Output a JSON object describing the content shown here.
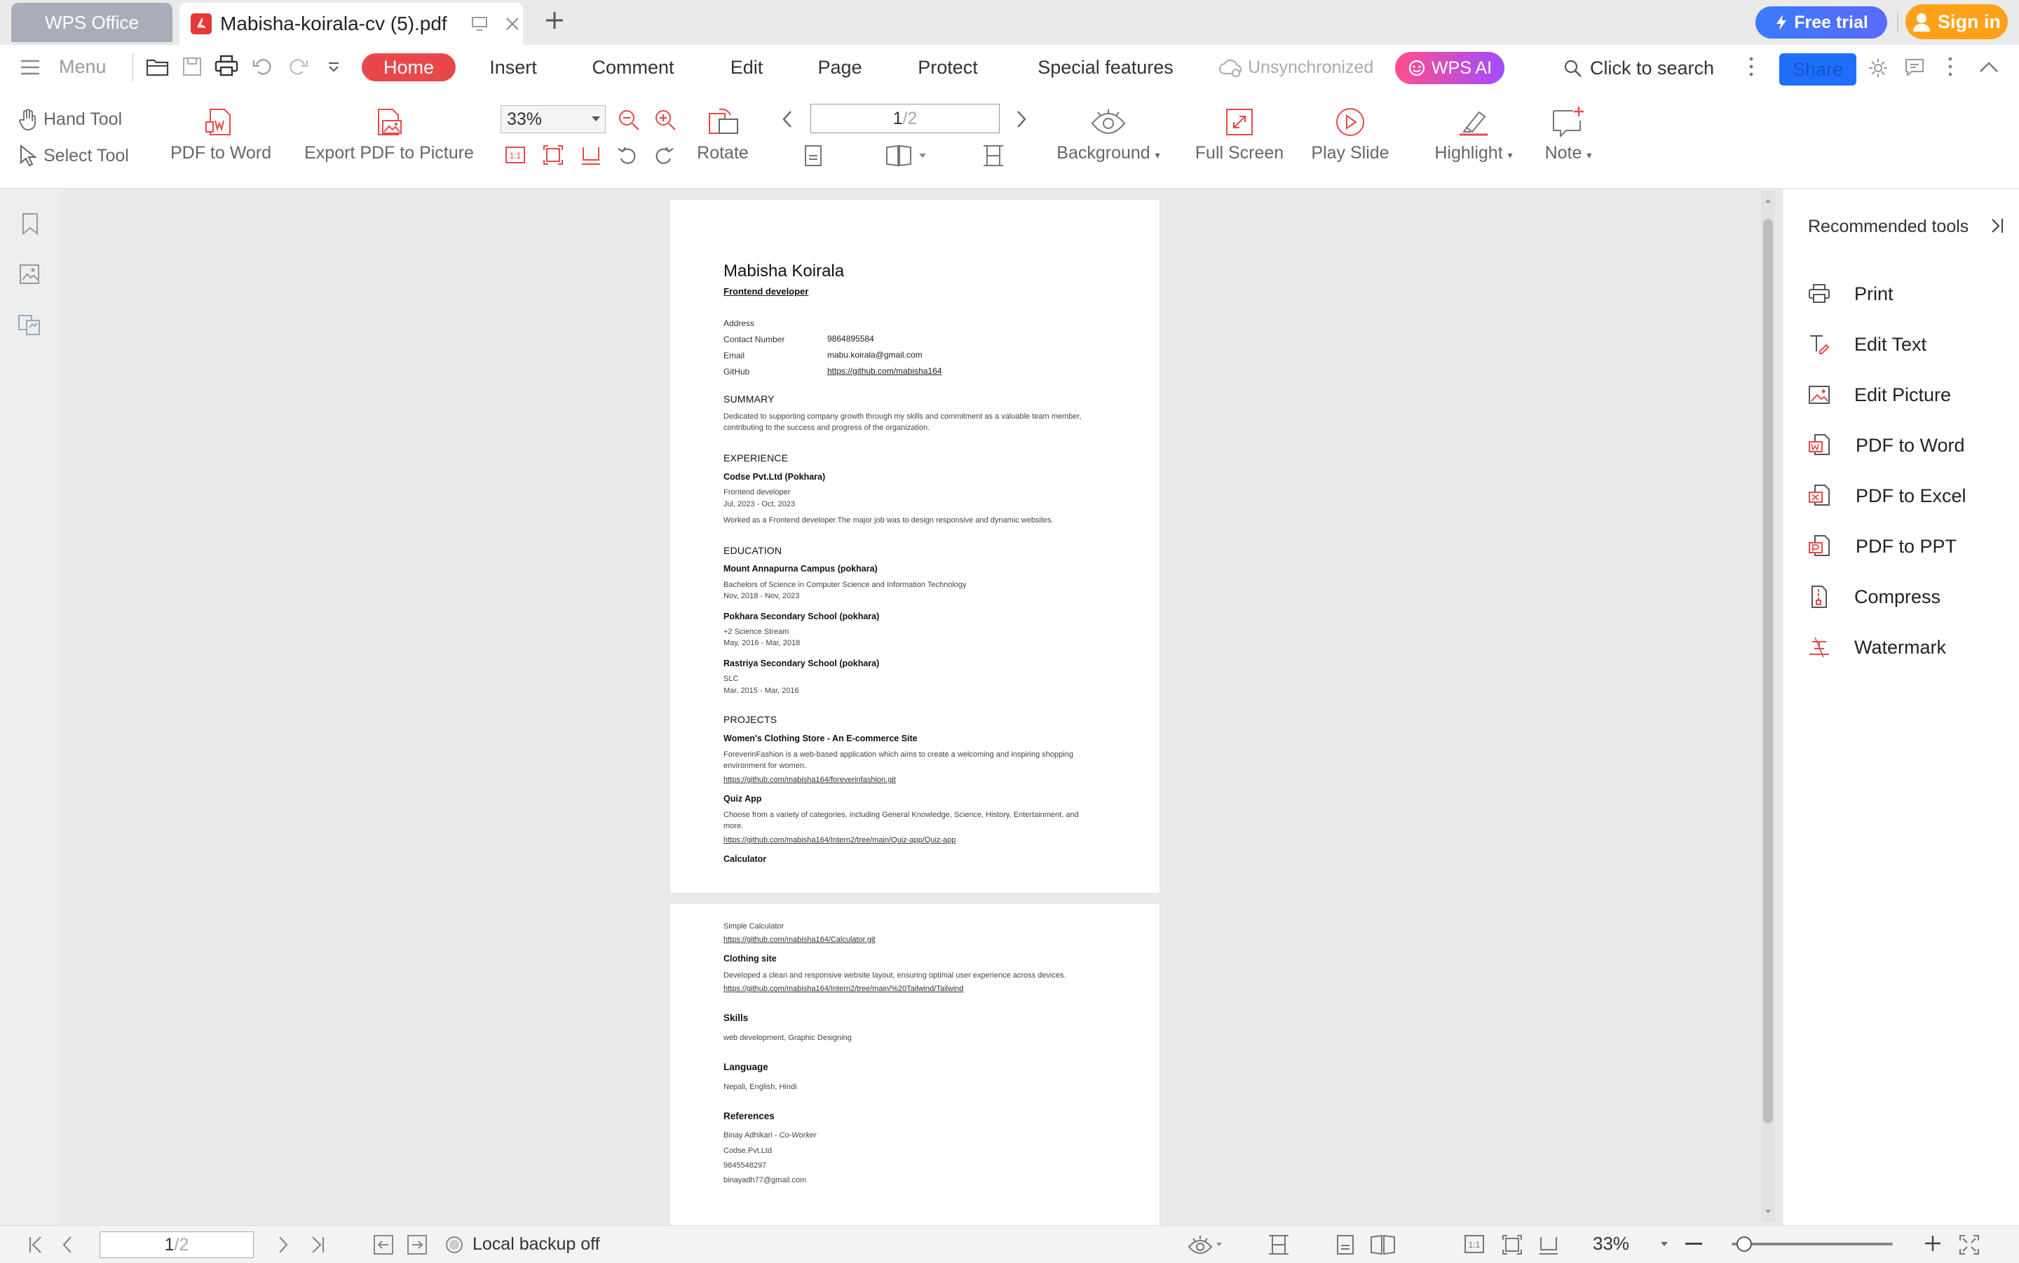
{
  "tabs": {
    "home_tab": "WPS Office",
    "doc_title": "Mabisha-koirala-cv (5).pdf",
    "free_trial": "Free trial",
    "sign_in": "Sign in"
  },
  "menu": {
    "menu_label": "Menu",
    "items": [
      "Home",
      "Insert",
      "Comment",
      "Edit",
      "Page",
      "Protect",
      "Special features"
    ],
    "sync_status": "Unsynchronized",
    "wps_ai": "WPS AI",
    "search": "Click to search",
    "share": "Share"
  },
  "toolbar": {
    "hand_tool": "Hand Tool",
    "select_tool": "Select Tool",
    "pdf_to_word": "PDF to Word",
    "export_picture": "Export PDF to Picture",
    "zoom": "33%",
    "rotate": "Rotate",
    "page_current": "1",
    "page_total": "/2",
    "background": "Background",
    "full_screen": "Full Screen",
    "play_slide": "Play Slide",
    "highlight": "Highlight",
    "note": "Note"
  },
  "right_panel": {
    "title": "Recommended tools",
    "items": [
      "Print",
      "Edit Text",
      "Edit Picture",
      "PDF to Word",
      "PDF to Excel",
      "PDF to PPT",
      "Compress",
      "Watermark"
    ]
  },
  "cv": {
    "name": "Mabisha Koirala",
    "role": "Frontend developer",
    "contact": {
      "address_label": "Address",
      "phone_label": "Contact Number",
      "phone": "9864895584",
      "email_label": "Email",
      "email": "mabu.koirala@gmail.com",
      "github_label": "GitHub",
      "github": "https://github.com/mabisha164"
    },
    "summary_title": "SUMMARY",
    "summary_l1": "Dedicated to supporting company growth through my skills and commitment as a valuable team member,",
    "summary_l2": "contributing to the success and progress of the organization.",
    "experience_title": "EXPERIENCE",
    "exp_company": "Codse Pvt.Ltd (Pokhara)",
    "exp_role": "Frontend developer",
    "exp_dates": "Jul, 2023 - Oct, 2023",
    "exp_desc": "Worked as a Frontend developer.The major job was to design responsive and dynamic websites.",
    "education_title": "EDUCATION",
    "edu1_school": "Mount Annapurna Campus (pokhara)",
    "edu1_degree": "Bachelors of Science in Computer Science and Information Technology",
    "edu1_dates": "Nov, 2018 - Nov, 2023",
    "edu2_school": "Pokhara Secondary School (pokhara)",
    "edu2_degree": "+2 Science Stream",
    "edu2_dates": "May, 2016 - Mar, 2018",
    "edu3_school": "Rastriya Secondary School (pokhara)",
    "edu3_degree": "SLC",
    "edu3_dates": "Mar, 2015 - Mar, 2016",
    "projects_title": "PROJECTS",
    "proj1_title": "Women's Clothing Store - An E-commerce Site",
    "proj1_l1": "ForeverinFashion is a web-based application which aims to create a welcoming and inspiring shopping",
    "proj1_l2": "environment for women.",
    "proj1_link": "https://github.com/mabisha164/foreverinfashion.git",
    "proj2_title": "Quiz App",
    "proj2_l1": "Choose from a variety of categories, including General Knowledge, Science, History, Entertainment, and",
    "proj2_l2": "more.",
    "proj2_link": "https://github.com/mabisha164/Intern2/tree/main/Quiz-app/Quiz-app",
    "proj3_title": "Calculator",
    "proj3_desc": "Simple Calculator",
    "proj3_link": "https://github.com/mabisha164/Calculator.git",
    "proj4_title": "Clothing site",
    "proj4_desc": "Developed a clean and responsive website layout, ensuring optimal user experience across devices.",
    "proj4_link": "https://github.com/mabisha164/Intern2/tree/main/%20Tailwind/Tailwind",
    "skills_title": "Skills",
    "skills": "web development, Graphic Designing",
    "language_title": "Language",
    "languages": "Nepali, English, Hindi",
    "references_title": "References",
    "ref_name": "Binay Adhikari",
    "ref_sep": " - ",
    "ref_role": "Co-Worker",
    "ref_company": "Codse.Pvt.Ltd",
    "ref_phone": "9845548297",
    "ref_email": "binayadh77@gmail.com"
  },
  "status": {
    "page_current": "1",
    "page_total": "/2",
    "backup": "Local backup off",
    "zoom": "33%",
    "zoom_level": 0.33
  },
  "colors": {
    "accent": "#e9484a",
    "share": "#1f6ffb",
    "free_trial": "#3a7bff",
    "sign_in": "#ffa21a"
  }
}
